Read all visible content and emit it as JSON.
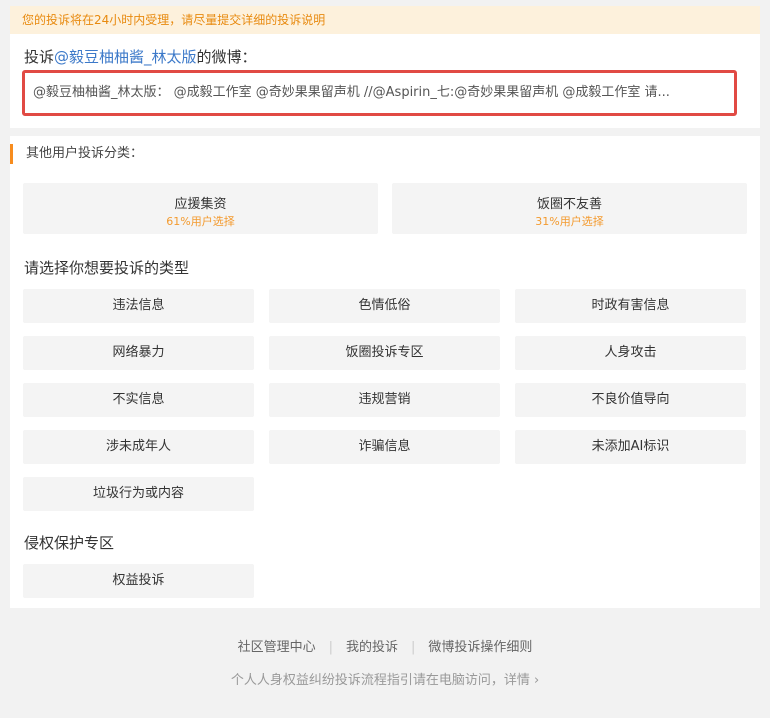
{
  "notice": "您的投诉将在24小时内受理，请尽量提交详细的投诉说明",
  "target": {
    "prefix": "投诉",
    "user": "@毅豆柚柚酱_林太版",
    "suffix": "的微博：",
    "post_text": "@毅豆柚柚酱_林太版： @成毅工作室 @奇妙果果留声机 //@Aspirin_七:@奇妙果果留声机 @成毅工作室 请..."
  },
  "other_users": {
    "title": "其他用户投诉分类：",
    "items": [
      {
        "name": "应援集资",
        "pct": "61%用户选择"
      },
      {
        "name": "饭圈不友善",
        "pct": "31%用户选择"
      }
    ]
  },
  "type_section": {
    "title": "请选择你想要投诉的类型",
    "items": [
      "违法信息",
      "色情低俗",
      "时政有害信息",
      "网络暴力",
      "饭圈投诉专区",
      "人身攻击",
      "不实信息",
      "违规营销",
      "不良价值导向",
      "涉未成年人",
      "诈骗信息",
      "未添加AI标识",
      "垃圾行为或内容"
    ]
  },
  "rights_section": {
    "title": "侵权保护专区",
    "items": [
      "权益投诉"
    ]
  },
  "footer": {
    "links": [
      "社区管理中心",
      "我的投诉",
      "微博投诉操作细则"
    ],
    "note": "个人人身权益纠纷投诉流程指引请在电脑访问，详情",
    "note_arrow": "›"
  }
}
